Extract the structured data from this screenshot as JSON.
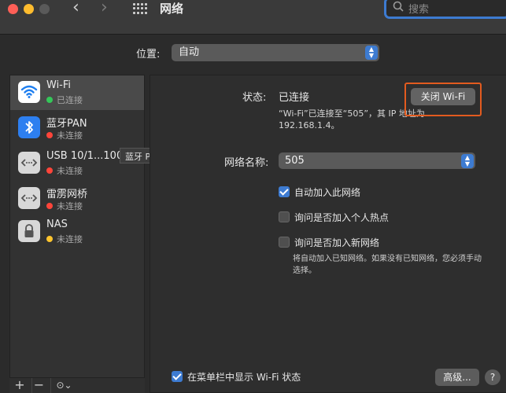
{
  "window": {
    "title": "网络",
    "search_placeholder": "搜索"
  },
  "location": {
    "label": "位置:",
    "value": "自动"
  },
  "sidebar": {
    "services": [
      {
        "name": "Wi-Fi",
        "status": "已连接",
        "status_color": "#34c759",
        "icon": "wifi-icon"
      },
      {
        "name": "蓝牙PAN",
        "status": "未连接",
        "status_color": "#ff453a",
        "icon": "bluetooth-icon"
      },
      {
        "name": "USB 10/1...1000",
        "status": "未连接",
        "status_color": "#ff453a",
        "icon": "ethernet-icon"
      },
      {
        "name": "雷雳网桥",
        "status": "未连接",
        "status_color": "#ff453a",
        "icon": "ethernet-icon"
      },
      {
        "name": "NAS",
        "status": "未连接",
        "status_color": "#ffc52e",
        "icon": "lock-icon"
      }
    ],
    "tooltip": "蓝牙 PAN",
    "toolbar": {
      "add": "+",
      "remove": "−",
      "action": "⊙⌄"
    }
  },
  "detail": {
    "status_label": "状态:",
    "status_value": "已连接",
    "status_desc": "“Wi-Fi”已连接至“505”，其 IP 地址为 192.168.1.4。",
    "wifi_off_button": "关闭 Wi-Fi",
    "network_name_label": "网络名称:",
    "network_name_value": "505",
    "checkboxes": [
      {
        "label": "自动加入此网络",
        "checked": true
      },
      {
        "label": "询问是否加入个人热点",
        "checked": false
      },
      {
        "label": "询问是否加入新网络",
        "checked": false
      }
    ],
    "note": "将自动加入已知网络。如果没有已知网络，您必须手动选择。",
    "show_in_menubar": {
      "label": "在菜单栏中显示 Wi-Fi 状态",
      "checked": true
    },
    "advanced_button": "高级...",
    "help_button": "?"
  },
  "colors": {
    "accent": "#3d7bd1",
    "highlight_box": "#e25b1f"
  }
}
